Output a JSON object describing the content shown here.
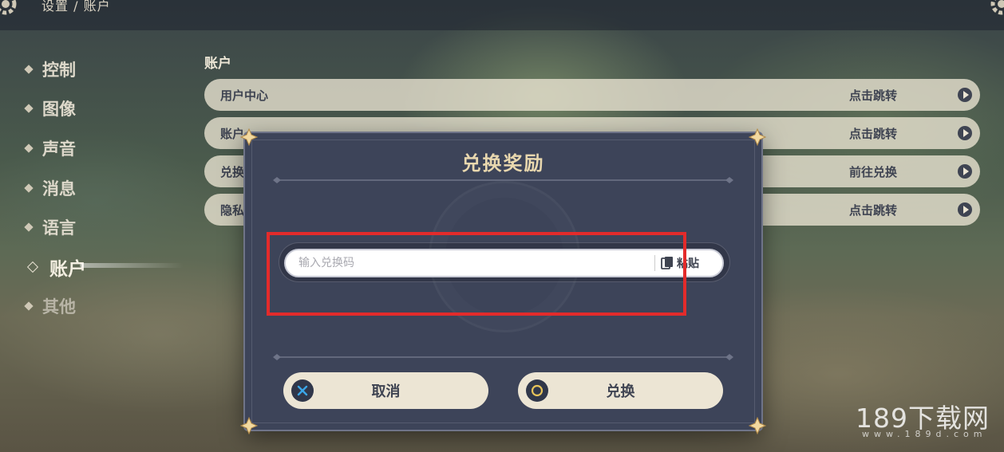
{
  "header": {
    "breadcrumb": "设置 / 账户"
  },
  "sidebar": {
    "items": [
      {
        "label": "控制"
      },
      {
        "label": "图像"
      },
      {
        "label": "声音"
      },
      {
        "label": "消息"
      },
      {
        "label": "语言"
      },
      {
        "label": "账户",
        "active": true
      },
      {
        "label": "其他"
      }
    ]
  },
  "main": {
    "section_title": "账户",
    "rows": [
      {
        "label": "用户中心",
        "action": "点击跳转"
      },
      {
        "label": "账户...",
        "action": "点击跳转"
      },
      {
        "label": "兑换...",
        "action": "前往兑换"
      },
      {
        "label": "隐私...",
        "action": "点击跳转"
      }
    ]
  },
  "dialog": {
    "title": "兑换奖励",
    "input_placeholder": "输入兑换码",
    "input_value": "",
    "paste_label": "粘贴",
    "cancel_label": "取消",
    "confirm_label": "兑换"
  },
  "watermark": {
    "text": "189下载网",
    "url": "www.189d.com"
  },
  "colors": {
    "dialog_bg": "#3d4459",
    "title_gold": "#e8d7ae",
    "button_bg": "#ece5d4",
    "highlight_red": "#e32b2b",
    "cancel_icon_blue": "#3ba6e8",
    "confirm_icon_gold": "#e6c35a"
  },
  "icons": [
    "gear-icon",
    "diamond-bullet-icon",
    "arrow-right-icon",
    "clipboard-icon",
    "cross-icon",
    "circle-icon",
    "corner-ornament-icon"
  ]
}
